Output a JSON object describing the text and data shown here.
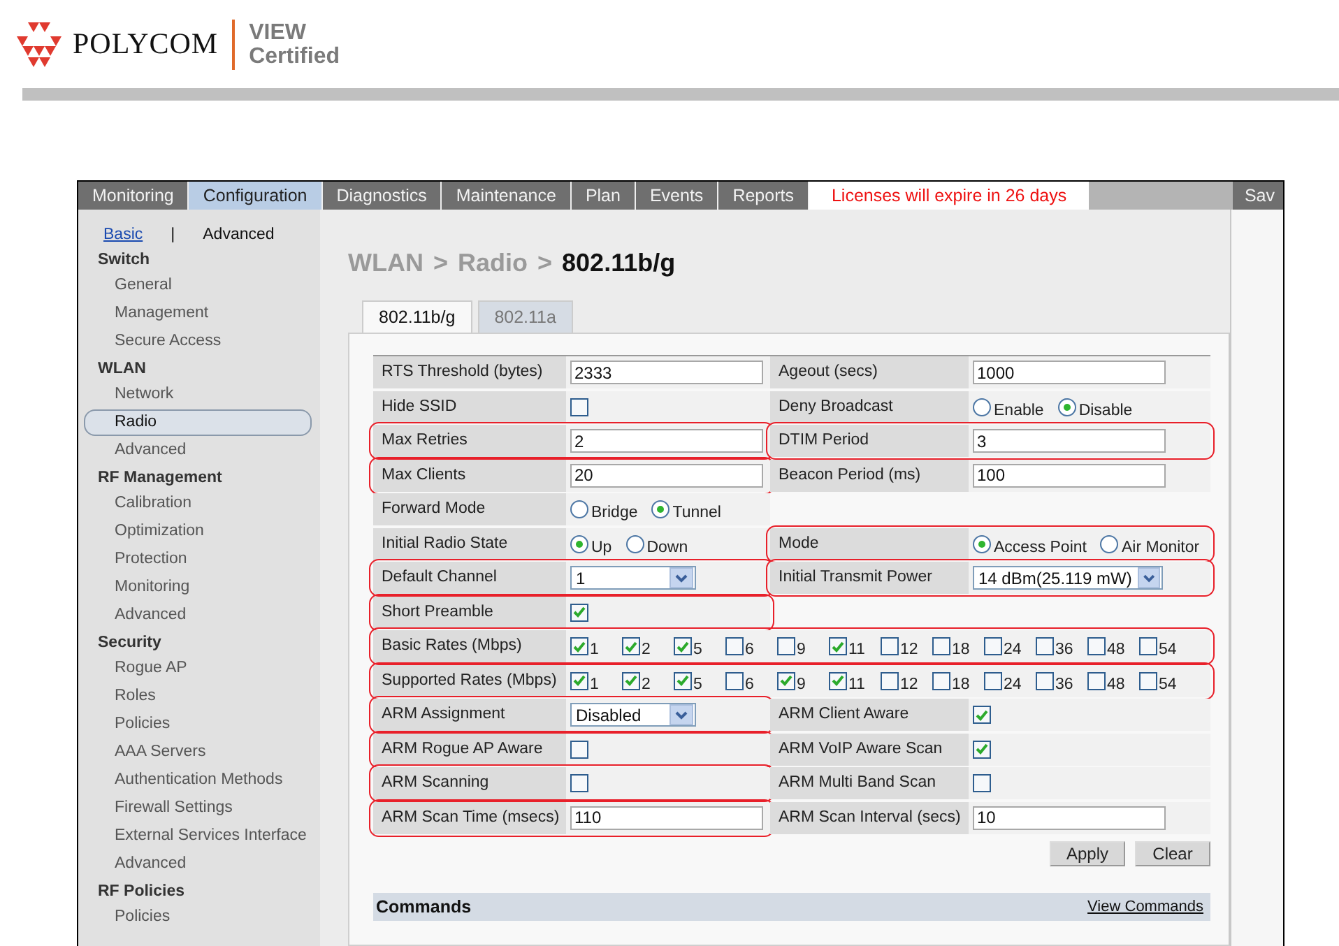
{
  "header": {
    "brand": "POLYCOM",
    "badge_lines": [
      "VIEW",
      "Certified"
    ]
  },
  "nav": {
    "tabs": [
      {
        "label": "Monitoring",
        "selected": false
      },
      {
        "label": "Configuration",
        "selected": true
      },
      {
        "label": "Diagnostics",
        "selected": false
      },
      {
        "label": "Maintenance",
        "selected": false
      },
      {
        "label": "Plan",
        "selected": false
      },
      {
        "label": "Events",
        "selected": false
      },
      {
        "label": "Reports",
        "selected": false
      }
    ],
    "notice": "Licenses will expire in 26 days",
    "save": "Sav"
  },
  "sidebar": {
    "modes": [
      {
        "label": "Basic",
        "kind": "link"
      },
      {
        "label": "|",
        "kind": "text"
      },
      {
        "label": "Advanced",
        "kind": "text"
      }
    ],
    "sections": [
      {
        "title": "Switch",
        "items": [
          {
            "label": "General",
            "selected": false
          },
          {
            "label": "Management",
            "selected": false
          },
          {
            "label": "Secure Access",
            "selected": false
          }
        ]
      },
      {
        "title": "WLAN",
        "items": [
          {
            "label": "Network",
            "selected": false
          },
          {
            "label": "Radio",
            "selected": true
          },
          {
            "label": "Advanced",
            "selected": false
          }
        ]
      },
      {
        "title": "RF Management",
        "items": [
          {
            "label": "Calibration",
            "selected": false
          },
          {
            "label": "Optimization",
            "selected": false
          },
          {
            "label": "Protection",
            "selected": false
          },
          {
            "label": "Monitoring",
            "selected": false
          },
          {
            "label": "Advanced",
            "selected": false
          }
        ]
      },
      {
        "title": "Security",
        "items": [
          {
            "label": "Rogue AP",
            "selected": false
          },
          {
            "label": "Roles",
            "selected": false
          },
          {
            "label": "Policies",
            "selected": false
          },
          {
            "label": "AAA Servers",
            "selected": false
          },
          {
            "label": "Authentication Methods",
            "selected": false
          },
          {
            "label": "Firewall Settings",
            "selected": false
          },
          {
            "label": "External Services Interface",
            "selected": false
          },
          {
            "label": "Advanced",
            "selected": false
          }
        ]
      },
      {
        "title": "RF Policies",
        "items": [
          {
            "label": "Policies",
            "selected": false
          }
        ]
      }
    ]
  },
  "breadcrumb": [
    {
      "text": "WLAN",
      "current": false
    },
    {
      "text": ">",
      "current": false
    },
    {
      "text": "Radio",
      "current": false
    },
    {
      "text": ">",
      "current": false
    },
    {
      "text": "802.11b/g",
      "current": true
    }
  ],
  "subtabs": [
    {
      "label": "802.11b/g",
      "selected": true
    },
    {
      "label": "802.11a",
      "selected": false
    }
  ],
  "form": {
    "rows": [
      {
        "kind": "pair",
        "cells": [
          {
            "label": "RTS Threshold (bytes)",
            "kind": "input",
            "value": "2333",
            "highlighted": false
          },
          {
            "label": "Ageout (secs)",
            "kind": "input",
            "value": "1000",
            "highlighted": false
          }
        ]
      },
      {
        "kind": "pair",
        "cells": [
          {
            "label": "Hide SSID",
            "kind": "checkbox",
            "checked": false,
            "highlighted": false
          },
          {
            "label": "Deny Broadcast",
            "kind": "radio",
            "options": [
              {
                "label": "Enable",
                "selected": false
              },
              {
                "label": "Disable",
                "selected": true
              }
            ],
            "highlighted": false
          }
        ]
      },
      {
        "kind": "pair",
        "cells": [
          {
            "label": "Max Retries",
            "kind": "input",
            "value": "2",
            "highlighted": true
          },
          {
            "label": "DTIM Period",
            "kind": "input",
            "value": "3",
            "highlighted": true
          }
        ]
      },
      {
        "kind": "pair",
        "cells": [
          {
            "label": "Max Clients",
            "kind": "input",
            "value": "20",
            "highlighted": true
          },
          {
            "label": "Beacon Period (ms)",
            "kind": "input",
            "value": "100",
            "highlighted": false
          }
        ]
      },
      {
        "kind": "pair",
        "cells": [
          {
            "label": "Forward Mode",
            "kind": "radio",
            "options": [
              {
                "label": "Bridge",
                "selected": false
              },
              {
                "label": "Tunnel",
                "selected": true
              }
            ],
            "highlighted": false
          }
        ]
      },
      {
        "kind": "pair",
        "cells": [
          {
            "label": "Initial Radio State",
            "kind": "radio",
            "options": [
              {
                "label": "Up",
                "selected": true
              },
              {
                "label": "Down",
                "selected": false
              }
            ],
            "highlighted": false
          },
          {
            "label": "Mode",
            "kind": "radio",
            "options": [
              {
                "label": "Access Point",
                "selected": true
              },
              {
                "label": "Air Monitor",
                "selected": false
              }
            ],
            "highlighted": true
          }
        ]
      },
      {
        "kind": "pair",
        "cells": [
          {
            "label": "Default Channel",
            "kind": "select",
            "value": "1",
            "highlighted": true
          },
          {
            "label": "Initial Transmit Power",
            "kind": "select",
            "value": "14 dBm(25.119 mW)",
            "highlighted": true
          }
        ]
      },
      {
        "kind": "pair",
        "cells": [
          {
            "label": "Short Preamble",
            "kind": "checkbox",
            "checked": true,
            "highlighted": true
          }
        ]
      },
      {
        "kind": "rates",
        "label": "Basic Rates (Mbps)",
        "highlighted": true,
        "options": [
          {
            "label": "1",
            "checked": true
          },
          {
            "label": "2",
            "checked": true
          },
          {
            "label": "5",
            "checked": true
          },
          {
            "label": "6",
            "checked": false
          },
          {
            "label": "9",
            "checked": false
          },
          {
            "label": "11",
            "checked": true
          },
          {
            "label": "12",
            "checked": false
          },
          {
            "label": "18",
            "checked": false
          },
          {
            "label": "24",
            "checked": false
          },
          {
            "label": "36",
            "checked": false
          },
          {
            "label": "48",
            "checked": false
          },
          {
            "label": "54",
            "checked": false
          }
        ]
      },
      {
        "kind": "rates",
        "label": "Supported Rates (Mbps)",
        "highlighted": true,
        "options": [
          {
            "label": "1",
            "checked": true
          },
          {
            "label": "2",
            "checked": true
          },
          {
            "label": "5",
            "checked": true
          },
          {
            "label": "6",
            "checked": false
          },
          {
            "label": "9",
            "checked": true
          },
          {
            "label": "11",
            "checked": true
          },
          {
            "label": "12",
            "checked": false
          },
          {
            "label": "18",
            "checked": false
          },
          {
            "label": "24",
            "checked": false
          },
          {
            "label": "36",
            "checked": false
          },
          {
            "label": "48",
            "checked": false
          },
          {
            "label": "54",
            "checked": false
          }
        ]
      },
      {
        "kind": "pair",
        "cells": [
          {
            "label": "ARM Assignment",
            "kind": "select",
            "value": "Disabled",
            "highlighted": true
          },
          {
            "label": "ARM Client Aware",
            "kind": "checkbox",
            "checked": true,
            "highlighted": false
          }
        ]
      },
      {
        "kind": "pair",
        "cells": [
          {
            "label": "ARM Rogue AP Aware",
            "kind": "checkbox",
            "checked": false,
            "highlighted": true
          },
          {
            "label": "ARM VoIP Aware Scan",
            "kind": "checkbox",
            "checked": true,
            "highlighted": false
          }
        ]
      },
      {
        "kind": "pair",
        "cells": [
          {
            "label": "ARM Scanning",
            "kind": "checkbox",
            "checked": false,
            "highlighted": true
          },
          {
            "label": "ARM Multi Band Scan",
            "kind": "checkbox",
            "checked": false,
            "highlighted": false
          }
        ]
      },
      {
        "kind": "pair",
        "cells": [
          {
            "label": "ARM Scan Time (msecs)",
            "kind": "input",
            "value": "110",
            "highlighted": true
          },
          {
            "label": "ARM Scan Interval (secs)",
            "kind": "input",
            "value": "10",
            "highlighted": false
          }
        ]
      }
    ]
  },
  "buttons": [
    "Apply",
    "Clear"
  ],
  "commands": {
    "title": "Commands",
    "link": "View Commands"
  }
}
